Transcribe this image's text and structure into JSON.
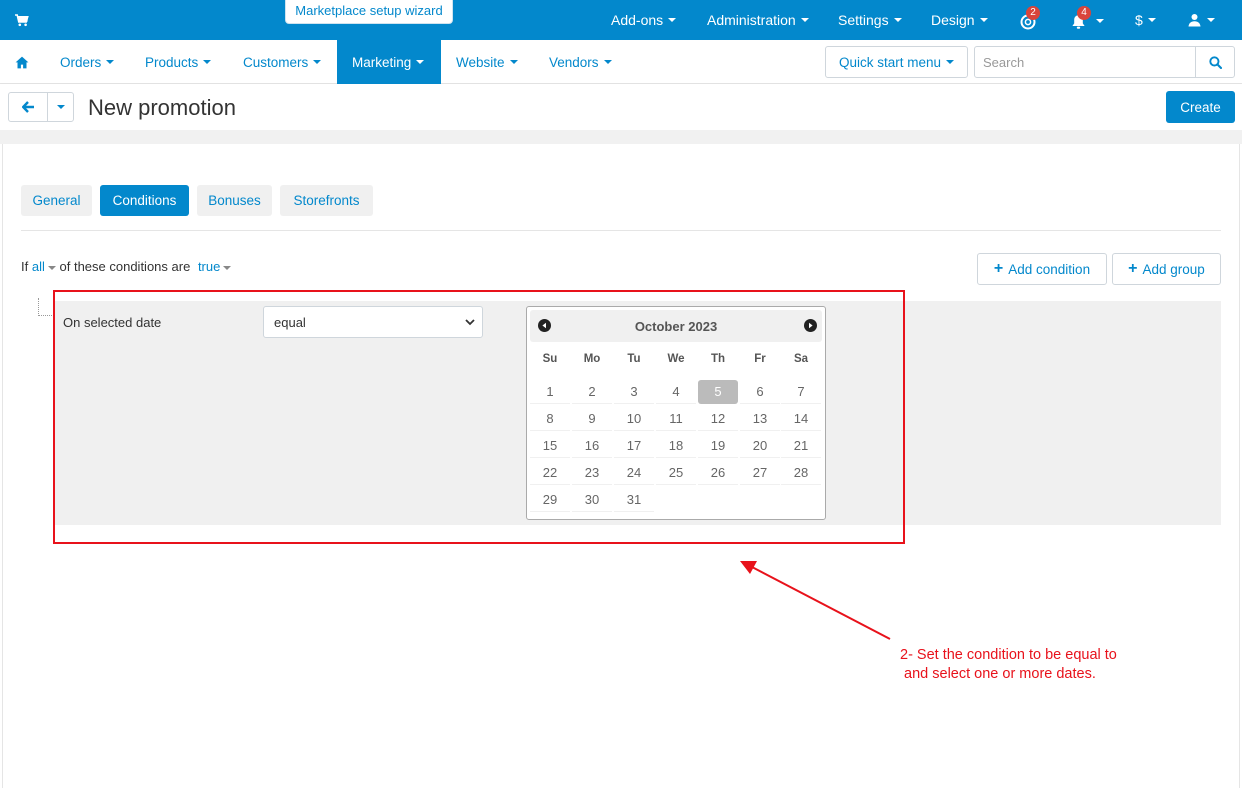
{
  "topbar": {
    "wizard_label": "Marketplace setup wizard",
    "menu": [
      {
        "label": "Add-ons"
      },
      {
        "label": "Administration"
      },
      {
        "label": "Settings"
      },
      {
        "label": "Design"
      }
    ],
    "help_badge": "2",
    "notifications_badge": "4",
    "currency_label": "$"
  },
  "nav": {
    "items": [
      {
        "label": "Orders"
      },
      {
        "label": "Products"
      },
      {
        "label": "Customers"
      },
      {
        "label": "Marketing"
      },
      {
        "label": "Website"
      },
      {
        "label": "Vendors"
      }
    ],
    "active": "Marketing",
    "quick_start_label": "Quick start menu",
    "search_placeholder": "Search"
  },
  "page": {
    "title": "New promotion",
    "create_label": "Create"
  },
  "tabs": [
    {
      "label": "General"
    },
    {
      "label": "Conditions"
    },
    {
      "label": "Bonuses"
    },
    {
      "label": "Storefronts"
    }
  ],
  "conditions": {
    "if_label": "If",
    "all_label": "all",
    "middle_label": "of these conditions are",
    "true_label": "true",
    "add_condition_label": "Add condition",
    "add_group_label": "Add group",
    "row_label": "On selected date",
    "operator_value": "equal"
  },
  "calendar": {
    "month_label": "October 2023",
    "weekdays": [
      "Su",
      "Mo",
      "Tu",
      "We",
      "Th",
      "Fr",
      "Sa"
    ],
    "first_weekday_index": 0,
    "days_in_month": 31,
    "selected_day": 5
  },
  "annotation": {
    "line1": "2- Set the condition to be equal to",
    "line2": " and select one or more dates."
  },
  "colors": {
    "brand": "#0388cc",
    "annotation": "#e8121b",
    "badge": "#d9453b"
  }
}
